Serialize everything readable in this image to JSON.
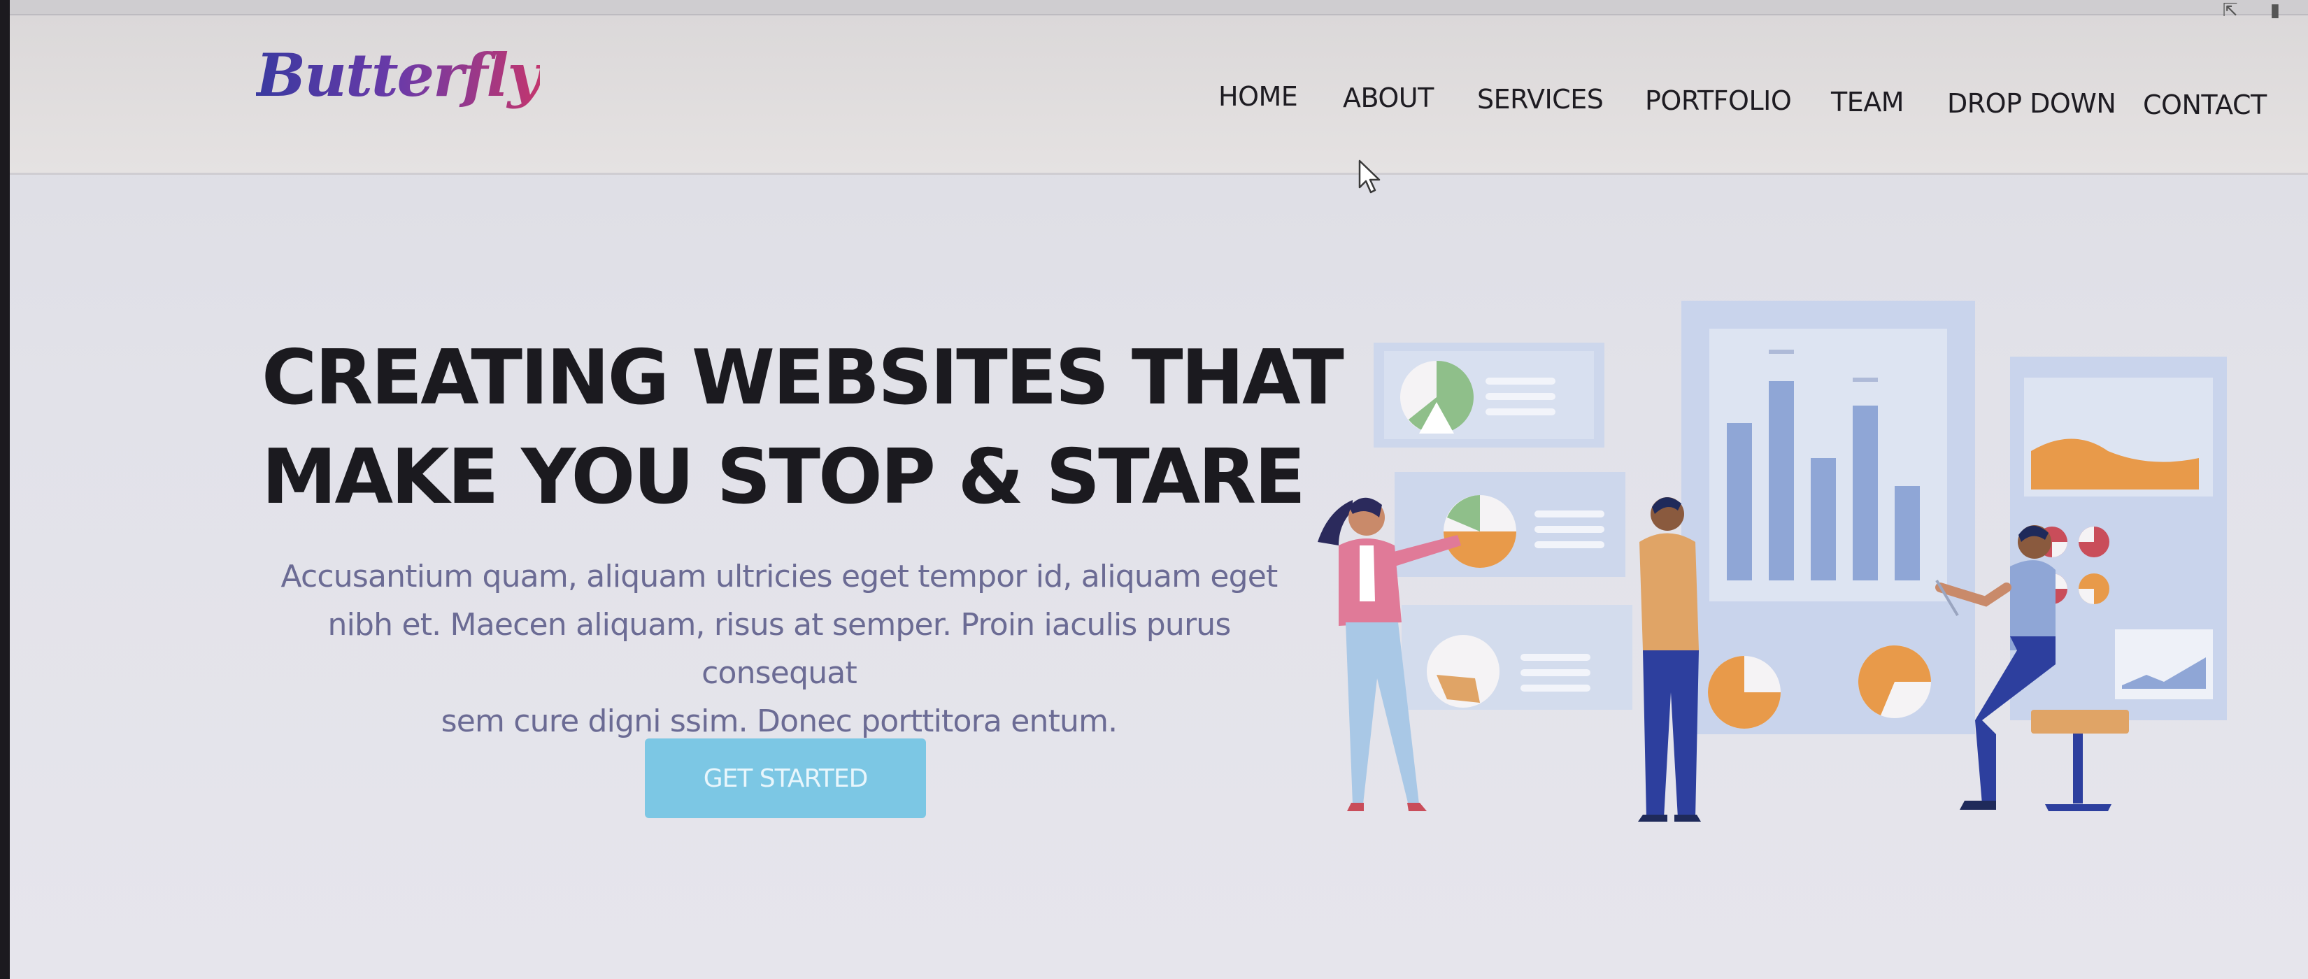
{
  "brand": {
    "logo_text": "Butterfly"
  },
  "nav": {
    "items": [
      {
        "label": "HOME"
      },
      {
        "label": "ABOUT"
      },
      {
        "label": "SERVICES"
      },
      {
        "label": "PORTFOLIO"
      },
      {
        "label": "TEAM"
      },
      {
        "label": "DROP DOWN"
      },
      {
        "label": "CONTACT"
      }
    ]
  },
  "hero": {
    "title_line1": "CREATING WEBSITES THAT",
    "title_line2": "MAKE YOU STOP & STARE",
    "subtitle_line1": "Accusantium quam, aliquam ultricies eget tempor id, aliquam eget",
    "subtitle_line2": "nibh et. Maecen aliquam, risus at semper. Proin iaculis purus consequat",
    "subtitle_line3": "sem cure digni ssim. Donec porttitora entum.",
    "cta_label": "GET STARTED"
  },
  "colors": {
    "cta": "#7cc7e4",
    "logo_gradient": [
      "#3a3aa0",
      "#c2366e"
    ],
    "illustration_accent": "#e89a4a",
    "illustration_blue": "#8fa6d6"
  },
  "icons": {
    "cursor": "mouse-pointer-icon",
    "illustration": "business-analytics-illustration"
  }
}
